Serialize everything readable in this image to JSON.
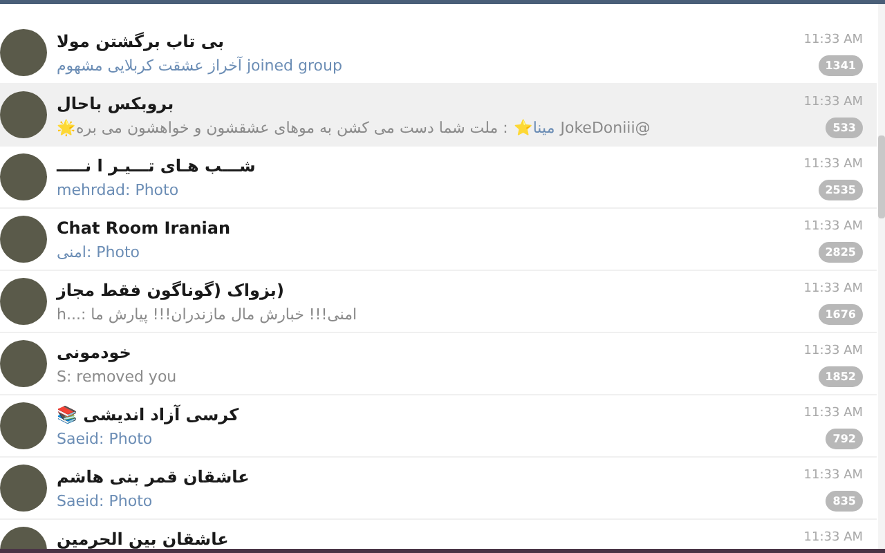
{
  "chats": [
    {
      "name": "بی تاب برگشتن مولا",
      "preview": [
        {
          "text": "آخراز عشقت کربلایی مشهوم joined group",
          "kind": "highlight"
        }
      ],
      "time": "11:33 AM",
      "unread": "1341",
      "selected": false
    },
    {
      "name": "بروبکس باحال",
      "preview": [
        {
          "text": "@JokeDoniii",
          "kind": "plain"
        },
        {
          "text": "مینا⭐",
          "kind": "highlight"
        },
        {
          "text": ": ملت شما دست می کشن به موهای عشقشون و خواهشون می بره🌟",
          "kind": "plain"
        }
      ],
      "time": "11:33 AM",
      "unread": "533",
      "selected": true
    },
    {
      "name": "شـــب هـای تـــیـر ا نـــــ",
      "preview": [
        {
          "text": "mehrdad: Photo",
          "kind": "highlight"
        }
      ],
      "time": "11:33 AM",
      "unread": "2535",
      "selected": false
    },
    {
      "name": "Chat Room Iranian",
      "preview": [
        {
          "text": "امنی: Photo",
          "kind": "highlight"
        }
      ],
      "time": "11:33 AM",
      "unread": "2825",
      "selected": false
    },
    {
      "name": "(بزواک (گوناگون فقط مجاز",
      "preview": [
        {
          "text": "h...: امنی!!! خبارش مال مازندران!!! پیارش ما",
          "kind": "plain"
        }
      ],
      "time": "11:33 AM",
      "unread": "1676",
      "selected": false
    },
    {
      "name": "خودمونی",
      "preview": [
        {
          "text": "S: removed you",
          "kind": "plain"
        }
      ],
      "time": "11:33 AM",
      "unread": "1852",
      "selected": false
    },
    {
      "name": "کرسی آزاد اندیشی 📚",
      "preview": [
        {
          "text": "Saeid: Photo",
          "kind": "highlight"
        }
      ],
      "time": "11:33 AM",
      "unread": "792",
      "selected": false
    },
    {
      "name": "عاشقان قمر بنی هاشم",
      "preview": [
        {
          "text": "Saeid: Photo",
          "kind": "highlight"
        }
      ],
      "time": "11:33 AM",
      "unread": "835",
      "selected": false
    },
    {
      "name": "عاشقان بین الحرمین",
      "time": "11:33 AM",
      "selected": false
    }
  ]
}
